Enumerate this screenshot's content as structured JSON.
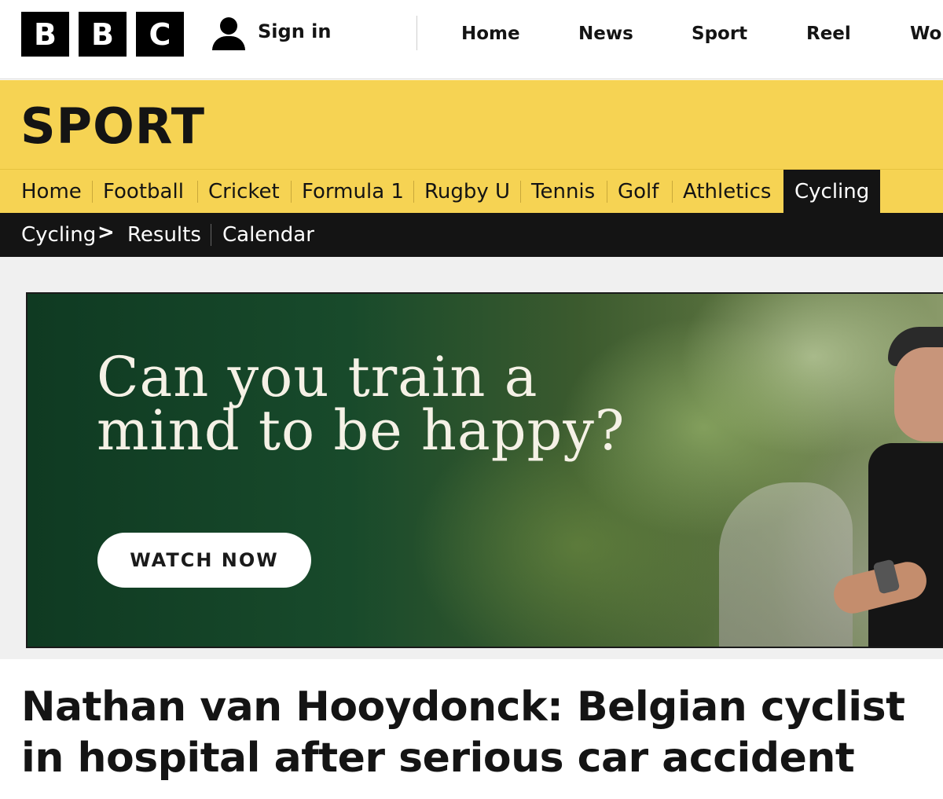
{
  "header": {
    "logo_letters": [
      "B",
      "B",
      "C"
    ],
    "sign_in": "Sign in",
    "nav": [
      "Home",
      "News",
      "Sport",
      "Reel",
      "Wor"
    ]
  },
  "sport": {
    "title": "SPORT",
    "nav": [
      "Home",
      "Football",
      "Cricket",
      "Formula 1",
      "Rugby U",
      "Tennis",
      "Golf",
      "Athletics",
      "Cycling"
    ],
    "active": "Cycling"
  },
  "cycling_bar": {
    "section": "Cycling",
    "chevron": ">",
    "links": [
      "Results",
      "Calendar"
    ]
  },
  "ad": {
    "headline_line1": "Can you train a",
    "headline_line2": "mind to be happy?",
    "cta": "WATCH NOW"
  },
  "article": {
    "title": "Nathan van Hooydonck: Belgian cyclist in hospital after serious car accident"
  },
  "colors": {
    "sport_yellow": "#f6d353",
    "dark_bar": "#141414",
    "ad_green": "#184a2b"
  }
}
